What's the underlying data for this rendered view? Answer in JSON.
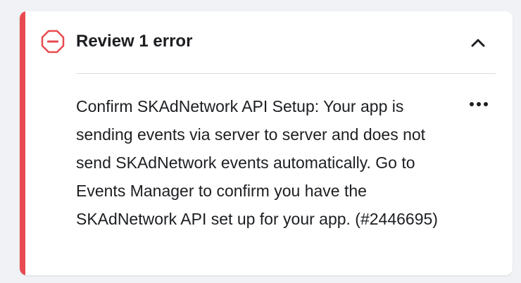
{
  "colors": {
    "accent": "#e84a4f",
    "text": "#1c1e21",
    "divider": "#dadde1",
    "background": "#f0f2f5",
    "card": "#ffffff"
  },
  "panel": {
    "title": "Review 1 error",
    "status_icon": "error-icon",
    "collapse_icon": "chevron-up-icon",
    "more_icon": "more-horizontal-icon"
  },
  "errors": [
    {
      "message": "Confirm SKAdNetwork API Setup: Your app is sending events via server to server and does not send SKAdNetwork events automatically. Go to Events Manager to confirm you have the SKAdNetwork API set up for your app. (#2446695)"
    }
  ]
}
